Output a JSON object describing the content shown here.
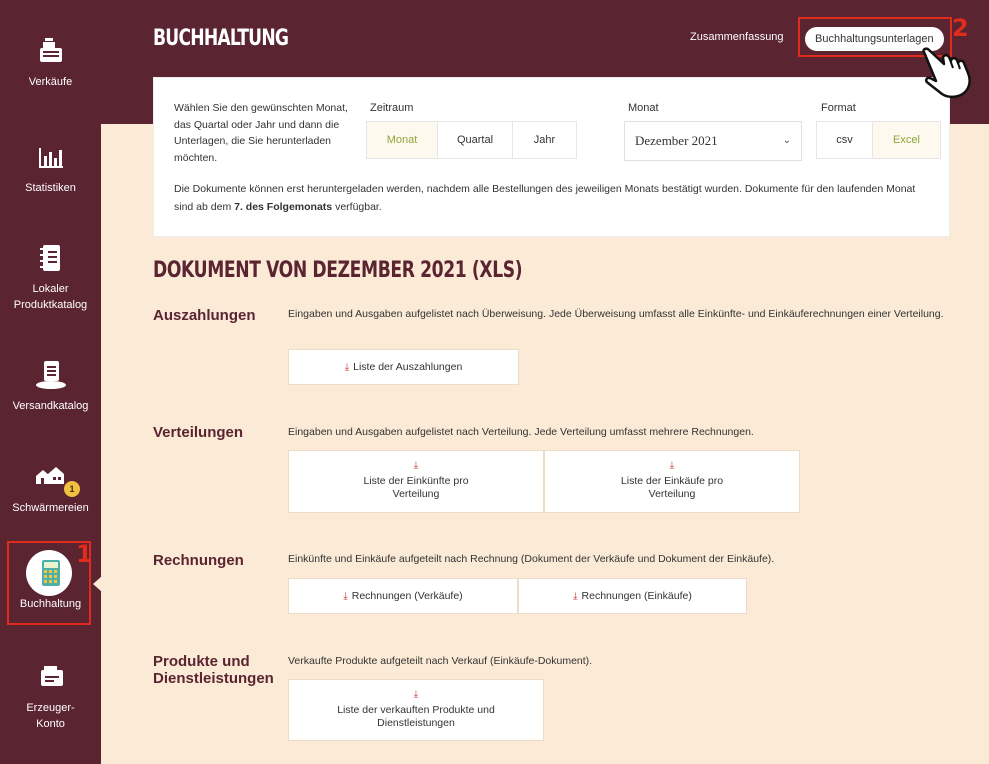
{
  "sidebar": {
    "items": [
      {
        "label": "Verkäufe",
        "icon": "cash-register-icon"
      },
      {
        "label": "Statistiken",
        "icon": "bar-chart-icon"
      },
      {
        "label": "Lokaler Produktkatalog",
        "icon": "notebook-icon"
      },
      {
        "label": "Versandkatalog",
        "icon": "catalog-box-icon"
      },
      {
        "label": "Schwärmereien",
        "icon": "houses-icon",
        "badge": "1"
      },
      {
        "label": "Buchhaltung",
        "icon": "calculator-icon",
        "active": true
      },
      {
        "label": "Erzeuger-Konto",
        "icon": "producer-account-icon"
      }
    ]
  },
  "annotations": {
    "marker_1": "1",
    "marker_2": "2"
  },
  "header": {
    "title": "BUCHHALTUNG",
    "link_summary": "Zusammenfassung",
    "link_documents": "Buchhaltungsunterlagen"
  },
  "filters": {
    "intro": "Wählen Sie den gewünschten Monat, das Quartal oder Jahr und dann die Unterlagen, die Sie herunterladen möchten.",
    "period_label": "Zeitraum",
    "period_options": [
      "Monat",
      "Quartal",
      "Jahr"
    ],
    "period_selected": "Monat",
    "month_label": "Monat",
    "month_value": "Dezember 2021",
    "format_label": "Format",
    "format_options": [
      "csv",
      "Excel"
    ],
    "format_selected": "Excel",
    "note_part1": "Die Dokumente können erst heruntergeladen werden, nachdem alle Bestellungen des jeweiligen Monats bestätigt wurden. Dokumente für den laufenden Monat sind ab dem ",
    "note_bold": "7. des Folgemonats",
    "note_part2": " verfügbar."
  },
  "document": {
    "title": "DOKUMENT VON DEZEMBER 2021 (XLS)",
    "sections": [
      {
        "title": "Auszahlungen",
        "description": "Eingaben und Ausgaben aufgelistet nach Überweisung. Jede Überweisung umfasst alle Einkünfte- und Einkäuferechnungen einer Verteilung.",
        "buttons": [
          "Liste der Auszahlungen"
        ]
      },
      {
        "title": "Verteilungen",
        "description": "Eingaben und Ausgaben aufgelistet nach Verteilung. Jede Verteilung umfasst mehrere Rechnungen.",
        "buttons": [
          "Liste der Einkünfte pro Verteilung",
          "Liste der Einkäufe pro Verteilung"
        ]
      },
      {
        "title": "Rechnungen",
        "description": "Einkünfte und Einkäufe aufgeteilt nach Rechnung (Dokument der Verkäufe und Dokument der Einkäufe).",
        "buttons": [
          "Rechnungen (Verkäufe)",
          "Rechnungen (Einkäufe)"
        ]
      },
      {
        "title": "Produkte und Dienstleistungen",
        "description": "Verkaufte Produkte aufgeteilt nach Verkauf (Einkäufe-Dokument).",
        "buttons": [
          "Liste der verkauften Produkte und Dienstleistungen"
        ]
      }
    ]
  },
  "colors": {
    "brand": "#5a2431",
    "background": "#fbebd6",
    "selected_text": "#8ea63c",
    "annotation_red": "#e02b1e",
    "badge": "#f0c040"
  }
}
